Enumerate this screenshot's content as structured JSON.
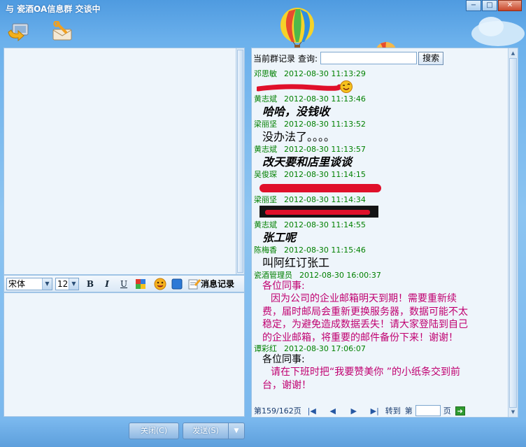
{
  "window": {
    "title": "与  瓷酒OA信息群  交谈中",
    "minimize": "−",
    "maximize": "□",
    "close": "✕"
  },
  "format_bar": {
    "font": "宋体",
    "size": "12",
    "bold": "B",
    "italic": "I",
    "underline": "U",
    "history_label": "消息记录"
  },
  "history": {
    "label": "当前群记录",
    "query_label": "查询:",
    "search_value": "",
    "search_button": "搜索"
  },
  "messages": [
    {
      "sender": "邓思敏",
      "time": "2012-08-30  11:13:29",
      "text": "",
      "style": "redacted"
    },
    {
      "sender": "黄志斌",
      "time": "2012-08-30  11:13:46",
      "text": "哈哈，没钱收",
      "style": "italic"
    },
    {
      "sender": "梁丽坚",
      "time": "2012-08-30  11:13:52",
      "text": "没办法了。。。。",
      "style": "plain"
    },
    {
      "sender": "黄志斌",
      "time": "2012-08-30  11:13:57",
      "text": "改天要和店里谈谈",
      "style": "italic"
    },
    {
      "sender": "吴俊琛",
      "time": "2012-08-30  11:14:15",
      "text": "",
      "style": "redacted"
    },
    {
      "sender": "梁丽坚",
      "time": "2012-08-30  11:14:34",
      "text": "",
      "style": "redacted"
    },
    {
      "sender": "黄志斌",
      "time": "2012-08-30  11:14:55",
      "text": "张工呢",
      "style": "italic"
    },
    {
      "sender": "陈梅香",
      "time": "2012-08-30  11:15:46",
      "text": "叫阿红订张工",
      "style": "plain"
    }
  ],
  "notice1": {
    "sender": "瓷酒管理员",
    "time": "2012-08-30  16:00:37",
    "greeting": "各位同事:",
    "lines": [
      "因为公司的企业邮箱明天到期！需要重新续",
      "费，届时邮局会重新更换服务器，数据可能不太",
      "稳定，为避免造成数据丢失！请大家登陆到自己",
      "的企业邮箱，将重要的邮件备份下来！谢谢！"
    ]
  },
  "notice2": {
    "sender": "谭彩红",
    "time": "2012-08-30  17:06:07",
    "greeting": "各位同事:",
    "lines": [
      "请在下班时把“我要赞美你 ”的小纸条交到前",
      "台，谢谢！"
    ]
  },
  "pager": {
    "status": "第159/162页",
    "goto_label": "转到",
    "di": "第",
    "page_value": "",
    "page_suffix": "页"
  },
  "buttons": {
    "close": "关闭(C)",
    "send": "发送(S)"
  },
  "colors": {
    "sender": "#008000",
    "notice": "#c00070",
    "redaction": "#e0102a"
  }
}
